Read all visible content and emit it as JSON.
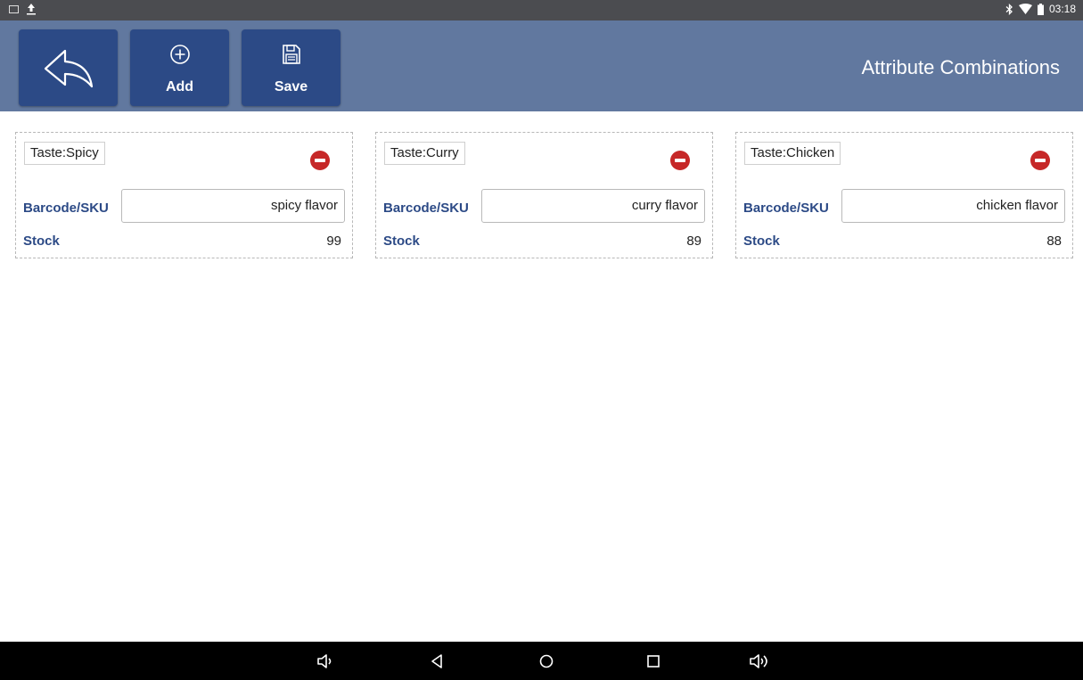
{
  "status_bar": {
    "time": "03:18",
    "icons": [
      "image-notification-icon",
      "upload-icon",
      "bluetooth-icon",
      "wifi-icon",
      "battery-icon"
    ]
  },
  "toolbar": {
    "back_icon": "back-arrow-icon",
    "add_label": "Add",
    "save_label": "Save",
    "title": "Attribute Combinations"
  },
  "labels": {
    "sku": "Barcode/SKU",
    "stock": "Stock"
  },
  "cards": [
    {
      "attribute": "Taste:Spicy",
      "sku": "spicy flavor",
      "stock": "99"
    },
    {
      "attribute": "Taste:Curry",
      "sku": "curry flavor",
      "stock": "89"
    },
    {
      "attribute": "Taste:Chicken",
      "sku": "chicken flavor",
      "stock": "88"
    }
  ],
  "colors": {
    "header_bg": "#61789f",
    "button_bg": "#2c4a86",
    "label_color": "#2c4a86",
    "remove_color": "#c62828"
  },
  "nav_icons": [
    "volume-down-icon",
    "back-icon",
    "home-icon",
    "recents-icon",
    "volume-up-icon"
  ]
}
